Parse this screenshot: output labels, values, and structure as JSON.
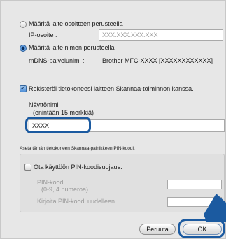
{
  "address_option": {
    "label": "Määritä laite osoitteen perusteella",
    "ip_label": "IP-osoite :",
    "ip_placeholder": "XXX.XXX.XXX.XXX"
  },
  "name_option": {
    "label": "Määritä laite nimen perusteella",
    "mdns_label": "mDNS-palvelunimi :",
    "mdns_value": "Brother MFC-XXXX   [XXXXXXXXXXXX]"
  },
  "register": {
    "checkbox_label": "Rekisteröi tietokoneesi laitteen Skannaa-toiminnon kanssa.",
    "display_name_label": "Näyttönimi",
    "display_name_hint": "(enintään 15 merkkiä)",
    "display_name_value": "XXXX"
  },
  "pin_section": {
    "caption": "Aseta tämän tietokoneen Skannaa-painikkeen PIN-koodi.",
    "enable_label": "Ota käyttöön PIN-koodisuojaus.",
    "pin_label": "PIN-koodi",
    "pin_hint": "(0-9, 4 numeroa)",
    "pin_repeat_label": "Kirjoita PIN-koodi uudelleen"
  },
  "buttons": {
    "cancel": "Peruuta",
    "ok": "OK"
  },
  "colors": {
    "highlight": "#1b5aa0",
    "dialog_bg": "#e7e7e7"
  }
}
